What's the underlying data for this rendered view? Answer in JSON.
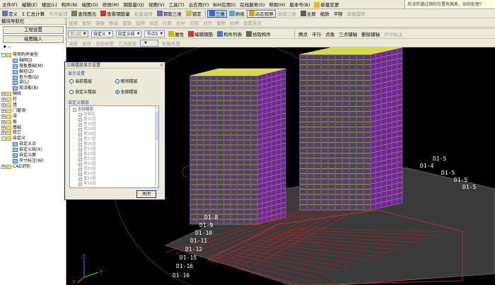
{
  "colors": {
    "menubar": "#ece9d8",
    "highlight_yellow": "#ffd700",
    "viewport_bg": "#000000",
    "building_purple": "#7b1fa2"
  },
  "menubar": {
    "items": [
      "文件(F)",
      "编辑(E)",
      "楼层(L)",
      "构件(N)",
      "绘图(D)",
      "修改(M)",
      "钢筋量(Q)",
      "视图(V)",
      "工具(T)",
      "云应用(Y)",
      "BIM应用(I)",
      "在线服务(S)",
      "帮助(H)",
      "版本号(B)"
    ],
    "extra": "新建变更",
    "help_prompt": "后浇带通过锁的位置有高差，如何处理?"
  },
  "toolbar1": {
    "definition": "定义",
    "sum": "Σ 汇总计算",
    "flat_check": "平齐板顶",
    "find_element": "查找图元",
    "view_rebar": "查看钢筋量",
    "batch_select": "批量选择",
    "rebar_3d": "钢筋三维",
    "lock": "锁定",
    "view3d": "三维",
    "browse": "俯视",
    "dynamic_view": "动态观察",
    "local_3d": "局部三维",
    "fullscreen": "全屏",
    "zoom": "缩放",
    "pan": "平移",
    "screen_rotate": "屏幕旋转"
  },
  "toolbar2": {
    "select": "选择",
    "point": "点加长度",
    "rotate_point": "旋转点",
    "copy": "复制",
    "mirror": "镜像",
    "move": "移动",
    "rotate": "旋转",
    "extend": "延伸",
    "trim": "修剪",
    "break": "打断",
    "merge": "合并",
    "split": "分割",
    "align": "对齐",
    "offset": "偏移",
    "stretch": "拉伸",
    "set_insert": "设置夹点"
  },
  "toolbar3": {
    "layer_combo": "第1层",
    "type_combo": "自定义",
    "subtype_combo": "自定义线",
    "elem_combo": "节点5",
    "properties": "属性",
    "edit_rebar": "编辑钢筋",
    "element_list": "构件列表",
    "pick": "拾取构件",
    "two_point": "两点",
    "parallel": "平行",
    "point_angle": "点角",
    "three_arc": "三点辅轴",
    "delete_axis": "删除辅轴",
    "dimension": "尺寸标注"
  },
  "toolbar4": {
    "select": "选择",
    "line": "直线",
    "point_length": "点加长度",
    "three_arc": "三点画弧",
    "smart_layout": "智能布置"
  },
  "leftpanel": {
    "title": "模块导航栏",
    "project_settings": "工程设置",
    "drawing_input": "绘图输入",
    "tree": [
      {
        "label": "常用构件类型",
        "depth": 0,
        "exp": "-",
        "icon": "folder"
      },
      {
        "label": "轴网(J)",
        "depth": 1,
        "exp": "",
        "icon": "leaf"
      },
      {
        "label": "筏板基础(M)",
        "depth": 1,
        "exp": "",
        "icon": "leaf"
      },
      {
        "label": "框柱(Z)",
        "depth": 1,
        "exp": "",
        "icon": "leaf"
      },
      {
        "label": "剪力墙(Q)",
        "depth": 1,
        "exp": "",
        "icon": "leaf"
      },
      {
        "label": "梁(L)",
        "depth": 1,
        "exp": "",
        "icon": "leaf"
      },
      {
        "label": "现浇板(B)",
        "depth": 1,
        "exp": "",
        "icon": "leaf"
      },
      {
        "label": "轴线",
        "depth": 0,
        "exp": "+",
        "icon": "folder"
      },
      {
        "label": "柱",
        "depth": 0,
        "exp": "+",
        "icon": "folder"
      },
      {
        "label": "墙",
        "depth": 0,
        "exp": "+",
        "icon": "folder"
      },
      {
        "label": "门窗洞",
        "depth": 0,
        "exp": "+",
        "icon": "folder"
      },
      {
        "label": "梁",
        "depth": 0,
        "exp": "+",
        "icon": "folder"
      },
      {
        "label": "板",
        "depth": 0,
        "exp": "+",
        "icon": "folder"
      },
      {
        "label": "基础",
        "depth": 0,
        "exp": "+",
        "icon": "folder"
      },
      {
        "label": "其它",
        "depth": 0,
        "exp": "+",
        "icon": "folder"
      },
      {
        "label": "自定义",
        "depth": 0,
        "exp": "-",
        "icon": "folder"
      },
      {
        "label": "自定义点",
        "depth": 1,
        "exp": "",
        "icon": "leaf"
      },
      {
        "label": "自定义线(X)",
        "depth": 1,
        "exp": "",
        "icon": "leaf"
      },
      {
        "label": "自定义面",
        "depth": 1,
        "exp": "",
        "icon": "leaf"
      },
      {
        "label": "尺寸标注(W)",
        "depth": 1,
        "exp": "",
        "icon": "leaf"
      },
      {
        "label": "CAD识别",
        "depth": 0,
        "exp": "+",
        "icon": "folder"
      }
    ]
  },
  "dialog": {
    "title": "三维楼层显示设置",
    "display_group": "显示设置",
    "current_floor": "当前楼层",
    "adjacent_floor": "相邻楼层",
    "custom_floor": "自定义楼层",
    "all_floors": "全部楼层",
    "custom_group": "自定义楼层",
    "list_root": "全部楼层",
    "floors": [
      "屋面层",
      "第31层",
      "第30层",
      "第29层",
      "第28层",
      "第27层",
      "第26层",
      "第25层",
      "第24层",
      "第23层",
      "第22层",
      "第21层",
      "第20层",
      "第19层",
      "第18层"
    ],
    "close": "关闭"
  },
  "viewport": {
    "labels": [
      "D1-16",
      "D1-16",
      "D1-15",
      "D1-12",
      "D1-11",
      "D1-10",
      "D1-9",
      "D1-8",
      "D1-4",
      "D1-5",
      "D1-5",
      "D1-5",
      "D1-5"
    ],
    "axis_x": "X",
    "axis_y": "Y",
    "axis_z": "Z"
  }
}
